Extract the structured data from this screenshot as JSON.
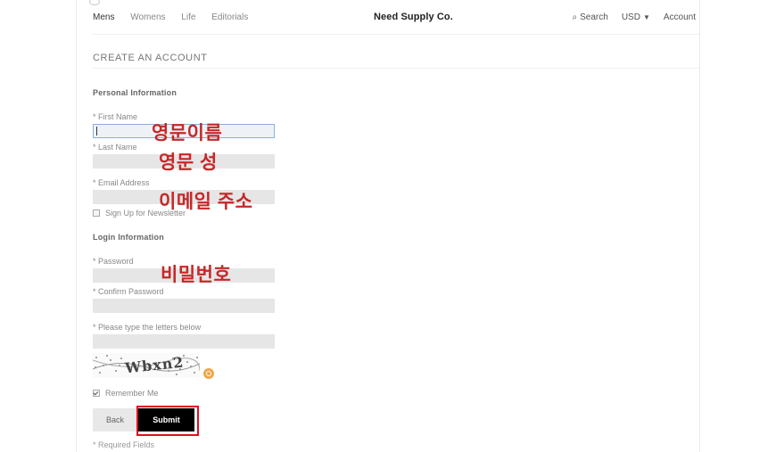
{
  "nav": {
    "links": [
      "Mens",
      "Womens",
      "Life",
      "Editorials"
    ],
    "brand": "Need Supply Co.",
    "search_label": "Search",
    "currency": "USD",
    "account": "Account"
  },
  "page": {
    "title": "CREATE AN ACCOUNT"
  },
  "personal": {
    "heading": "Personal Information",
    "first_name_label": "* First Name",
    "last_name_label": "* Last Name",
    "email_label": "* Email Address",
    "newsletter_label": "Sign Up for Newsletter"
  },
  "login": {
    "heading": "Login Information",
    "password_label": "* Password",
    "confirm_label": "* Confirm Password",
    "captcha_label": "* Please type the letters below",
    "captcha_text": "Wbxn2",
    "remember_label": "Remember Me"
  },
  "buttons": {
    "back": "Back",
    "submit": "Submit"
  },
  "footer": {
    "required": "* Required Fields"
  },
  "annotations": {
    "first_name": "영문이름",
    "last_name": "영문 성",
    "email": "이메일 주소",
    "password": "비밀번호"
  },
  "colors": {
    "annotation": "#c62828",
    "highlight": "#e0101c",
    "submit_bg": "#000000"
  }
}
